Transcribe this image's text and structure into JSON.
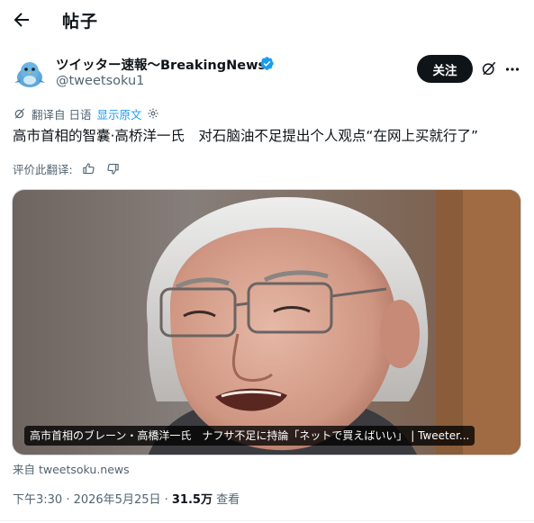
{
  "header": {
    "back_icon": "arrow-left-icon",
    "title": "帖子"
  },
  "author": {
    "name": "ツイッター速報〜BreakingNews",
    "handle": "@tweetsoku1",
    "verified_color": "#1d9bf0",
    "avatar_icon": "blue-bird-avatar",
    "follow_label": "关注",
    "grok_icon": "grok-icon",
    "more_icon": "more-dots-icon"
  },
  "translation": {
    "translated_from": "翻译自 日语",
    "show_original": "显示原文",
    "settings_icon": "gear-icon"
  },
  "post": {
    "text": "高市首相的智囊·高桥洋一氏　对石脑油不足提出个人观点“在网上买就行了”"
  },
  "rating": {
    "label": "评价此翻译:",
    "thumbs_up_icon": "thumbs-up-icon",
    "thumbs_down_icon": "thumbs-down-icon"
  },
  "media": {
    "caption": "高市首相のブレーン・高橋洋一氏　ナフサ不足に持論「ネットで買えばいい」 | Tweeter..."
  },
  "source": "来自 tweetsoku.news",
  "meta": {
    "time": "下午3:30 · 2026年5月25日 · ",
    "views": "31.5万",
    "views_label": " 查看"
  },
  "colors": {
    "accent": "#1d9bf0",
    "text": "#0f1419",
    "muted": "#536471"
  }
}
